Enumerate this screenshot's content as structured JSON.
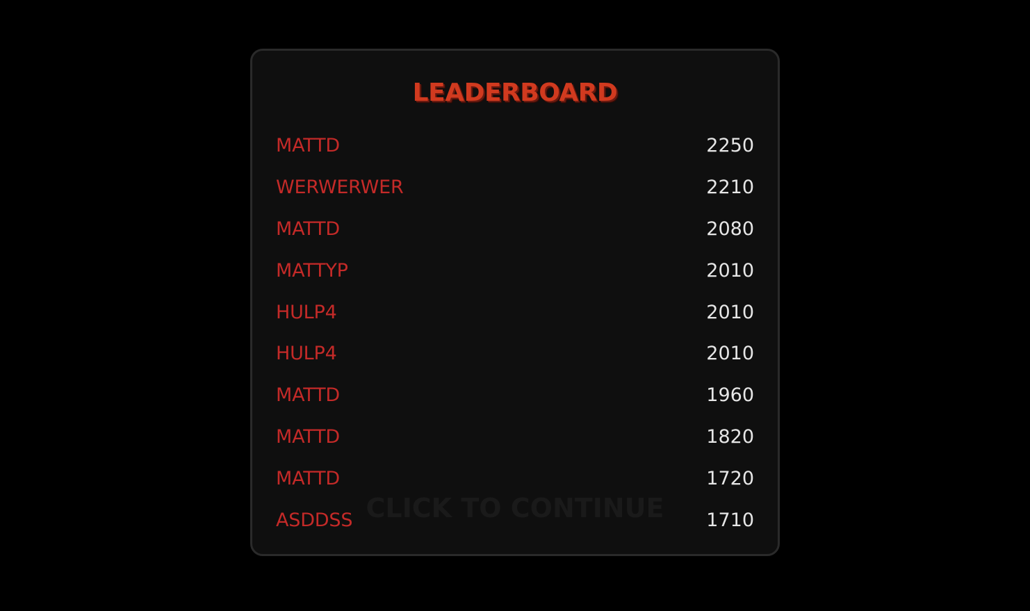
{
  "leaderboard": {
    "title": "LEADERBOARD",
    "entries": [
      {
        "name": "MATTD",
        "score": "2250"
      },
      {
        "name": "WERWERWER",
        "score": "2210"
      },
      {
        "name": "MATTD",
        "score": "2080"
      },
      {
        "name": "MATTYP",
        "score": "2010"
      },
      {
        "name": "HULP4",
        "score": "2010"
      },
      {
        "name": "HULP4",
        "score": "2010"
      },
      {
        "name": "MATTD",
        "score": "1960"
      },
      {
        "name": "MATTD",
        "score": "1820"
      },
      {
        "name": "MATTD",
        "score": "1720"
      },
      {
        "name": "ASDDSS",
        "score": "1710"
      }
    ],
    "continue_label": "CLICK TO CONTINUE"
  },
  "colors": {
    "background": "#000000",
    "panel": "#0f0f0f",
    "panel_border": "#2a2a2a",
    "title": "#d13a1f",
    "name": "#c42a28",
    "score": "#e6e6e6",
    "continue": "#1a1a1a"
  }
}
